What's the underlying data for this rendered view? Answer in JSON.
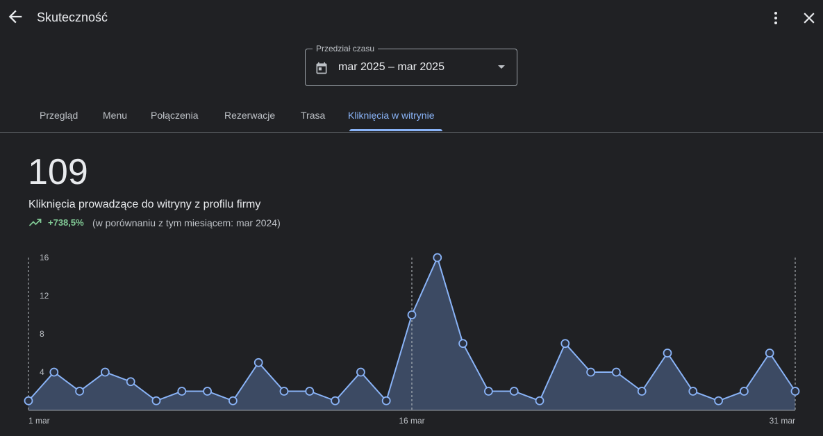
{
  "header": {
    "title": "Skuteczność",
    "back_icon": "arrow-back-icon",
    "more_icon": "more-vert-icon",
    "close_icon": "close-icon"
  },
  "date_range": {
    "legend": "Przedział czasu",
    "value": "mar 2025 – mar 2025",
    "icon": "calendar-icon"
  },
  "tabs": [
    {
      "label": "Przegląd"
    },
    {
      "label": "Menu"
    },
    {
      "label": "Połączenia"
    },
    {
      "label": "Rezerwacje"
    },
    {
      "label": "Trasa"
    },
    {
      "label": "Kliknięcia w witrynie",
      "active": true
    }
  ],
  "summary": {
    "total": "109",
    "label": "Kliknięcia prowadzące do witryny z profilu firmy",
    "change": "+738,5%",
    "comparison": "(w porównaniu z tym miesiącem: mar 2024)",
    "trend_icon": "trending-up-icon"
  },
  "colors": {
    "accent": "#8ab4f8",
    "positive": "#81c995",
    "area_fill": "#3c4a63",
    "background": "#202124"
  },
  "chart_data": {
    "type": "area",
    "x": [
      1,
      2,
      3,
      4,
      5,
      6,
      7,
      8,
      9,
      10,
      11,
      12,
      13,
      14,
      15,
      16,
      17,
      18,
      19,
      20,
      21,
      22,
      23,
      24,
      25,
      26,
      27,
      28,
      29,
      30,
      31
    ],
    "series": [
      {
        "values": [
          1,
          4,
          2,
          4,
          3,
          1,
          2,
          2,
          1,
          5,
          2,
          2,
          1,
          4,
          1,
          10,
          16,
          7,
          2,
          2,
          1,
          7,
          4,
          4,
          2,
          6,
          2,
          1,
          2,
          6,
          2
        ]
      }
    ],
    "x_tick_labels": [
      {
        "x": 1,
        "label": "1 mar"
      },
      {
        "x": 16,
        "label": "16 mar"
      },
      {
        "x": 31,
        "label": "31 mar"
      }
    ],
    "y_ticks": [
      4,
      8,
      12,
      16
    ],
    "ylim": [
      0,
      16
    ],
    "xlim": [
      1,
      31
    ],
    "grid": false,
    "legend": "none"
  }
}
